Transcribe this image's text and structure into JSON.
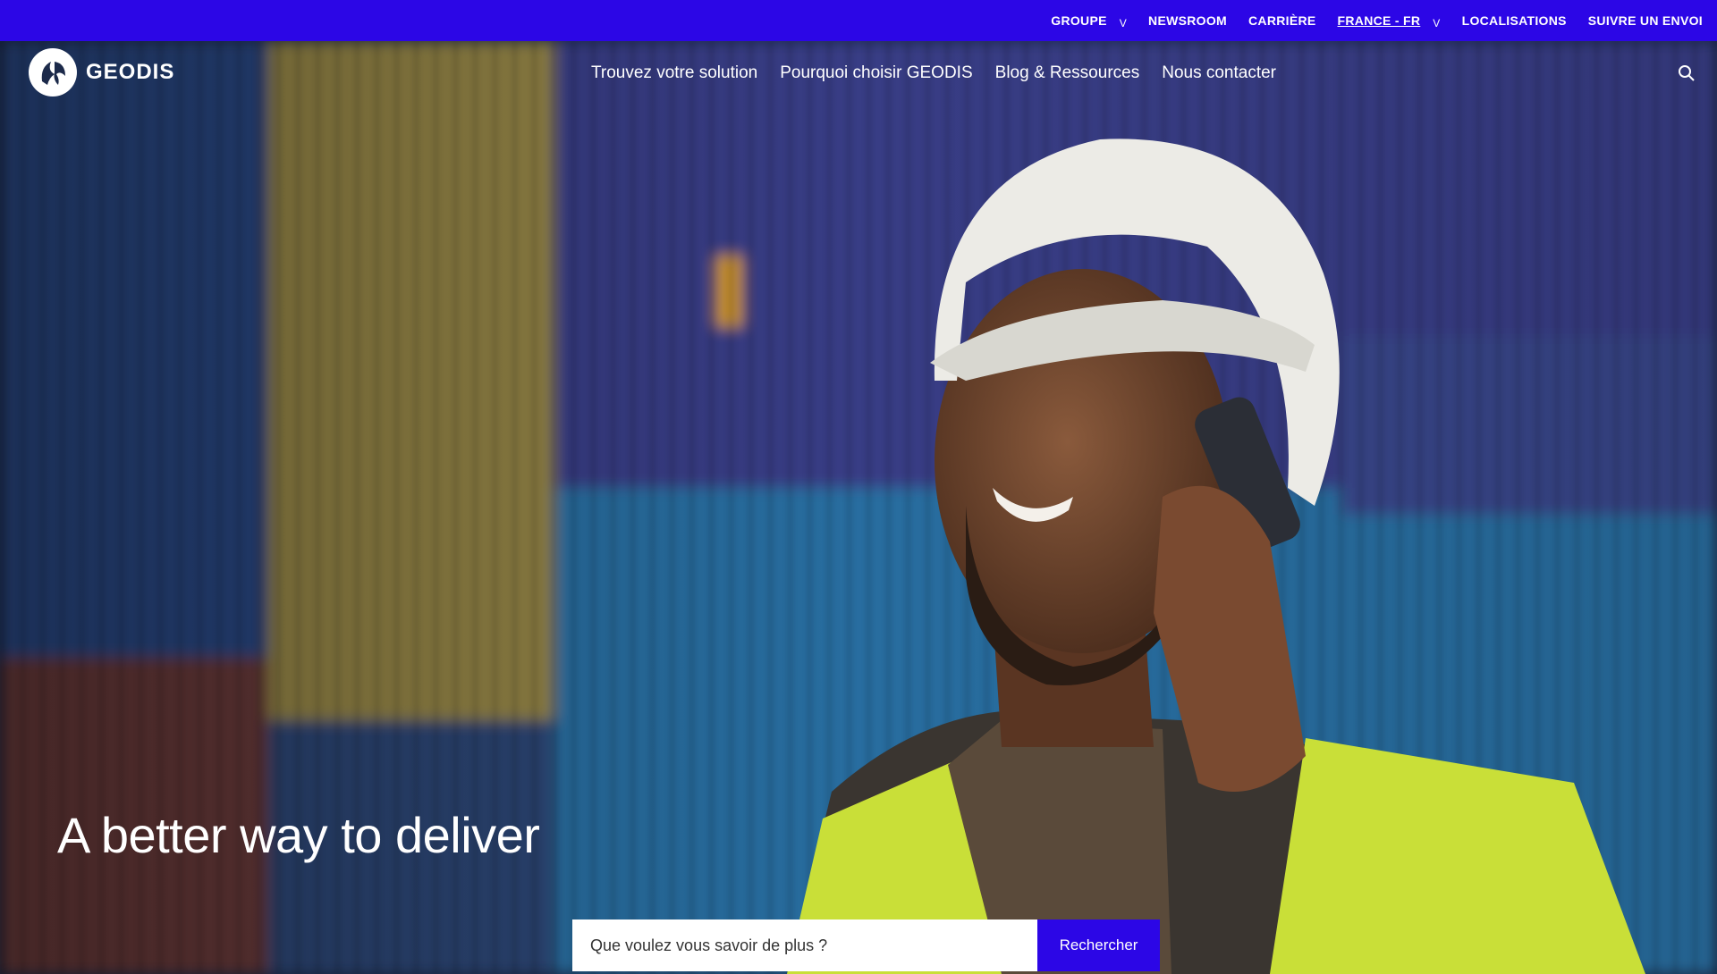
{
  "topbar": {
    "links": [
      {
        "label": "GROUPE",
        "dropdown": true
      },
      {
        "label": "NEWSROOM",
        "dropdown": false
      },
      {
        "label": "CARRIÈRE",
        "dropdown": false
      },
      {
        "label": "FRANCE - FR",
        "dropdown": true
      },
      {
        "label": "LOCALISATIONS",
        "dropdown": false
      },
      {
        "label": "SUIVRE UN ENVOI",
        "dropdown": false
      }
    ],
    "chevron": "v"
  },
  "brand": {
    "name": "GEODIS",
    "logo_icon": "geodis-logo-icon"
  },
  "nav": {
    "items": [
      "Trouvez votre solution",
      "Pourquoi choisir GEODIS",
      "Blog & Ressources",
      "Nous contacter"
    ]
  },
  "hero": {
    "title": "A better way to deliver"
  },
  "search": {
    "placeholder": "Que voulez vous savoir de plus ?",
    "button_label": "Rechercher"
  },
  "colors": {
    "accent": "#2c06e6"
  }
}
